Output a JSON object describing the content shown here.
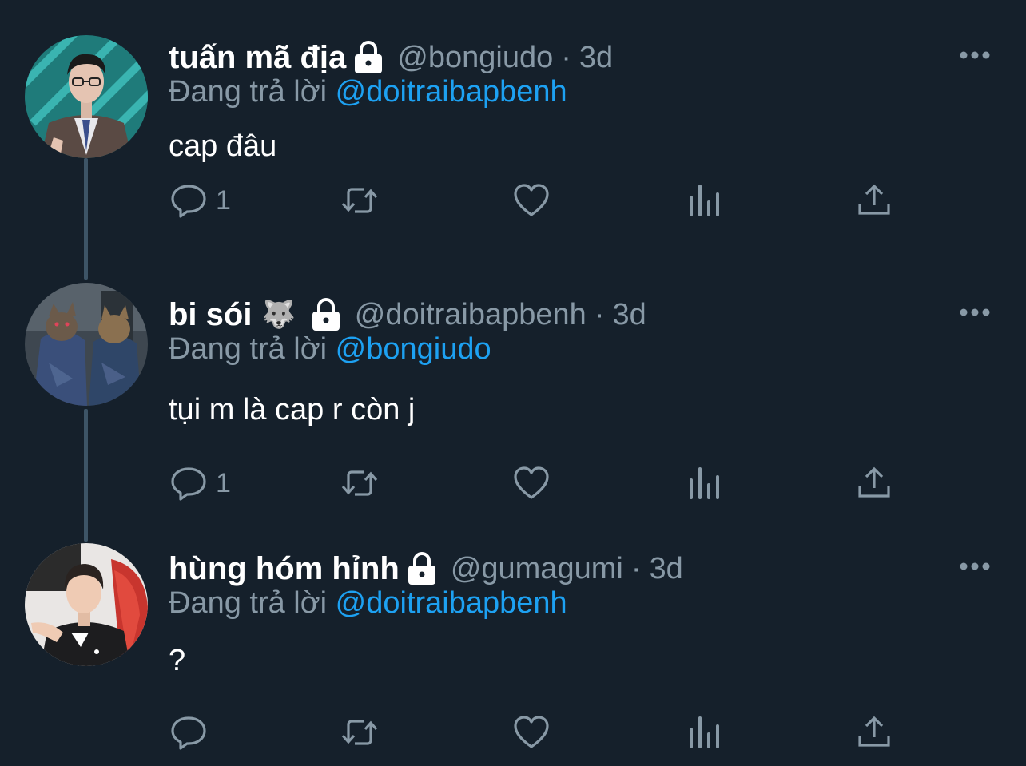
{
  "colors": {
    "background": "#15202b",
    "text_primary": "#ffffff",
    "text_secondary": "#8899a6",
    "link": "#1da1f2",
    "thread_line": "#3d5466"
  },
  "tweets": [
    {
      "display_name": "tuấn mã địa",
      "emoji": "",
      "lock_icon": "lock-icon",
      "handle": "@bongiudo",
      "separator": "·",
      "time": "3d",
      "reply_prefix": "Đang trả lời",
      "reply_to": "@doitraibapbenh",
      "text": "cap đâu",
      "reply_count": "1",
      "more_icon": "more-icon"
    },
    {
      "display_name": "bi sói",
      "emoji": "🐺",
      "lock_icon": "lock-icon",
      "handle": "@doitraibapbenh",
      "separator": "·",
      "time": "3d",
      "reply_prefix": "Đang trả lời",
      "reply_to": "@bongiudo",
      "text": "tụi m là cap r còn j",
      "reply_count": "1",
      "more_icon": "more-icon"
    },
    {
      "display_name": "hùng hóm hỉnh",
      "emoji": "",
      "lock_icon": "lock-icon",
      "handle": "@gumagumi",
      "separator": "·",
      "time": "3d",
      "reply_prefix": "Đang trả lời",
      "reply_to": "@doitraibapbenh",
      "text": "?",
      "reply_count": "",
      "more_icon": "more-icon"
    }
  ],
  "action_icons": [
    "reply-icon",
    "retweet-icon",
    "like-icon",
    "analytics-icon",
    "share-icon"
  ]
}
